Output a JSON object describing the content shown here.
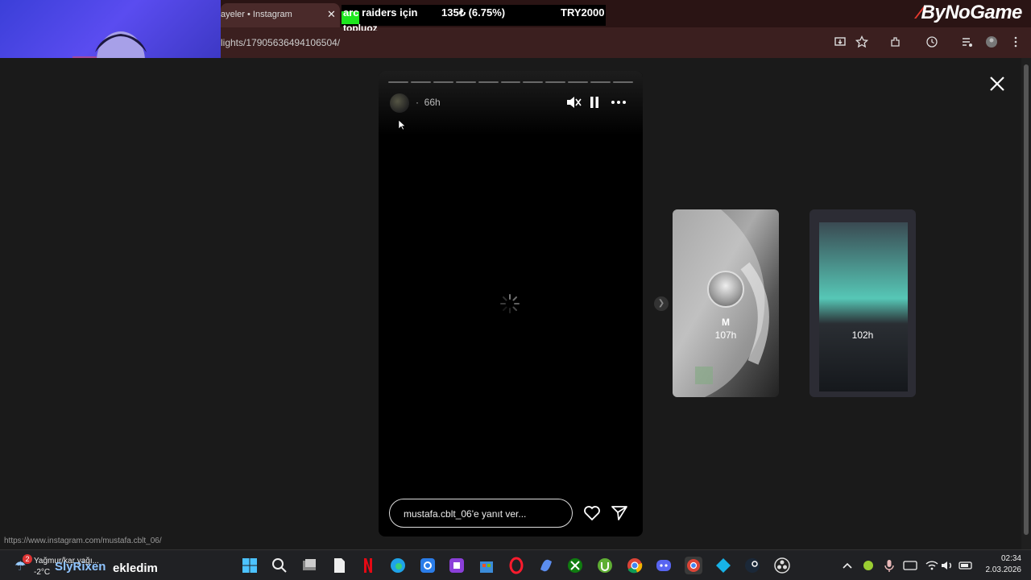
{
  "browser": {
    "tab_title": "ayeler • Instagram",
    "tab_close": "✕",
    "url": "lights/17905636494106504/",
    "status_url": "https://www.instagram.com/mustafa.cblt_06/"
  },
  "ticker": {
    "game": "arc raiders için",
    "change": "135₺ (6.75%)",
    "target": "TRY2000",
    "sub": "topluoz"
  },
  "brand": {
    "mark": "⁄",
    "name": "ByNoGame"
  },
  "story": {
    "segments": 11,
    "user_separator": "·",
    "time": "66h",
    "reply_placeholder": "mustafa.cblt_06'e yanıt ver..."
  },
  "thumbs": [
    {
      "name": "M",
      "time": "107h"
    },
    {
      "name": "",
      "time": "102h"
    }
  ],
  "taskbar": {
    "weather_badge": "2",
    "weather_condition": "Yağmur/kar yağı...",
    "weather_temp": "-2°C",
    "time": "02:34",
    "date": "2.03.2026"
  },
  "overlay": {
    "name": "SlyRixen",
    "action": "ekledim"
  },
  "colors": {
    "browser_frame": "#3b1f1f",
    "page_bg": "#1a1a1a",
    "story_bg": "#000000",
    "ticker_green": "#1ee61e",
    "brand_red": "#e63a2e",
    "overlay_name": "#8fc4ff"
  }
}
